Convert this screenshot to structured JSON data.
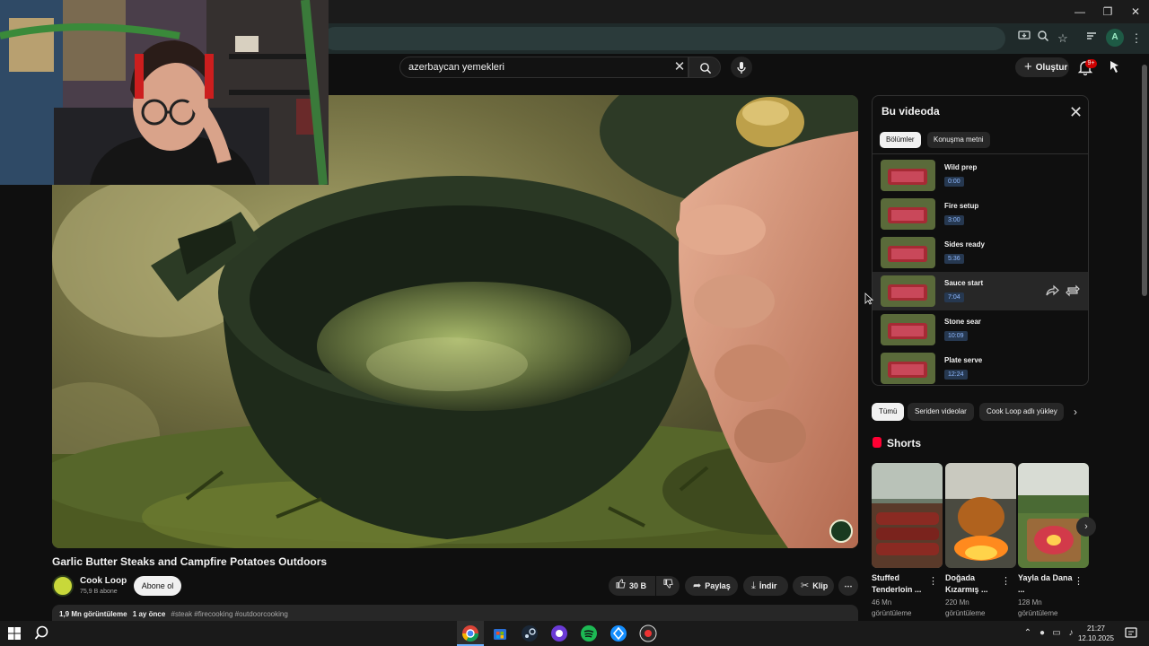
{
  "browser": {
    "minimize_label": "—",
    "restore_label": "❐",
    "close_label": "✕",
    "profile_initial": "A"
  },
  "header": {
    "search_value": "azerbaycan yemekleri",
    "create_label": "Oluştur",
    "notification_count": "9+"
  },
  "video": {
    "title": "Garlic Butter Steaks and Campfire Potatoes Outdoors",
    "channel_name": "Cook Loop",
    "subscribers": "75,9 B abone",
    "subscribe_label": "Abone ol",
    "likes": "30 B",
    "share_label": "Paylaş",
    "download_label": "İndir",
    "clip_label": "Klip",
    "views": "1,9 Mn görüntüleme",
    "age": "1 ay önce",
    "tags": "#steak #firecooking #outdoorcooking"
  },
  "chapters": {
    "heading": "Bu videoda",
    "tabs": [
      "Bölümler",
      "Konuşma metni"
    ],
    "items": [
      {
        "title": "Wild prep",
        "time": "0:00"
      },
      {
        "title": "Fire setup",
        "time": "3:00"
      },
      {
        "title": "Sides ready",
        "time": "5:36"
      },
      {
        "title": "Sauce start",
        "time": "7:04"
      },
      {
        "title": "Stone sear",
        "time": "10:09"
      },
      {
        "title": "Plate serve",
        "time": "12:24"
      }
    ]
  },
  "filters": [
    "Tümü",
    "Seriden videolar",
    "Cook Loop adlı yükley"
  ],
  "shorts": {
    "heading": "Shorts",
    "items": [
      {
        "title": "Stuffed Tenderloin ...",
        "views": "46 Mn görüntüleme"
      },
      {
        "title": "Doğada Kızarmış ...",
        "views": "220 Mn görüntüleme"
      },
      {
        "title": "Yayla da Dana ...",
        "views": "128 Mn görüntüleme"
      }
    ]
  },
  "taskbar": {
    "time": "21:27",
    "date": "12.10.2025"
  }
}
